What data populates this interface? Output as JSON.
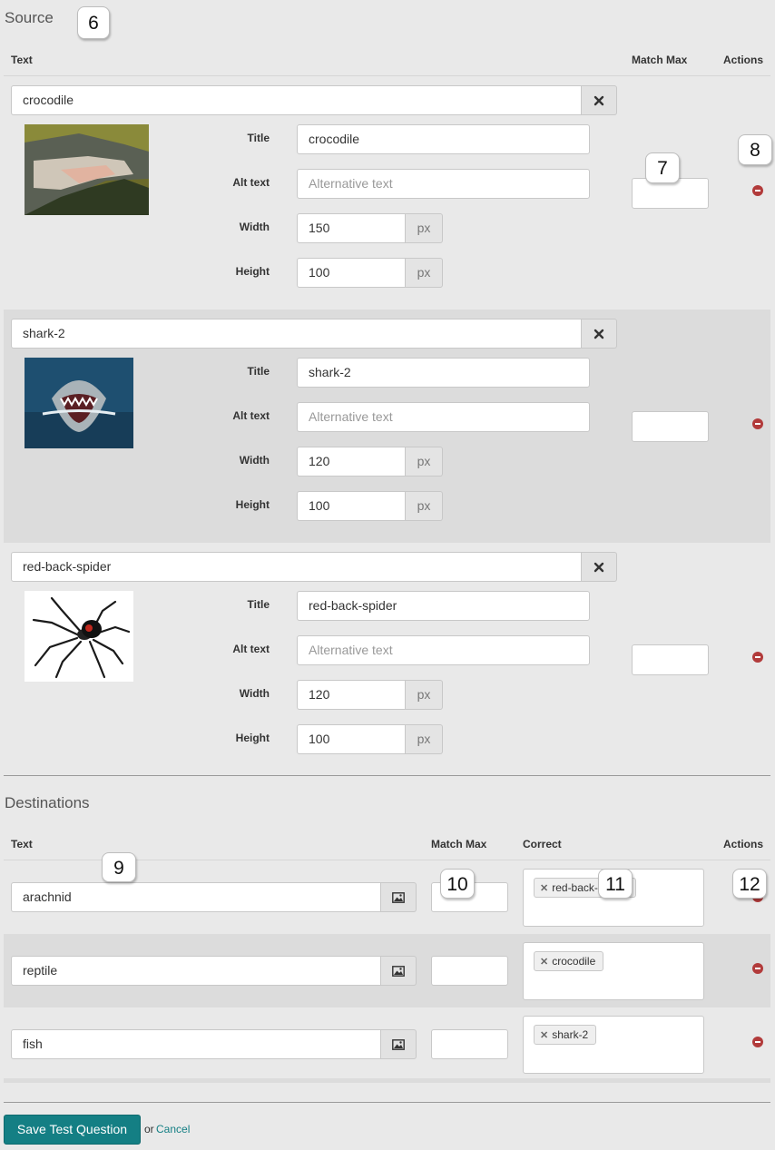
{
  "source": {
    "title": "Source",
    "col_text": "Text",
    "col_match_max": "Match Max",
    "col_actions": "Actions",
    "field_labels": {
      "title": "Title",
      "alt": "Alt text",
      "width": "Width",
      "height": "Height"
    },
    "unit": "px",
    "alt_placeholder": "Alternative text",
    "items": [
      {
        "text": "crocodile",
        "title": "crocodile",
        "width": "150",
        "height": "100",
        "image": "crocodile-photo"
      },
      {
        "text": "shark-2",
        "title": "shark-2",
        "width": "120",
        "height": "100",
        "image": "shark-photo"
      },
      {
        "text": "red-back-spider",
        "title": "red-back-spider",
        "width": "120",
        "height": "100",
        "image": "spider-photo"
      }
    ]
  },
  "destinations": {
    "title": "Destinations",
    "col_text": "Text",
    "col_match_max": "Match Max",
    "col_correct": "Correct",
    "col_actions": "Actions",
    "items": [
      {
        "text": "arachnid",
        "correct": [
          "red-back-spider"
        ]
      },
      {
        "text": "reptile",
        "correct": [
          "crocodile"
        ]
      },
      {
        "text": "fish",
        "correct": [
          "shark-2"
        ]
      }
    ]
  },
  "callouts": [
    "6",
    "7",
    "8",
    "9",
    "10",
    "11",
    "12"
  ],
  "footer": {
    "save_label": "Save Test Question",
    "or_text": "or",
    "cancel_label": "Cancel"
  },
  "colors": {
    "save": "#147f84",
    "remove": "#b23b3b",
    "link": "#147f84"
  }
}
